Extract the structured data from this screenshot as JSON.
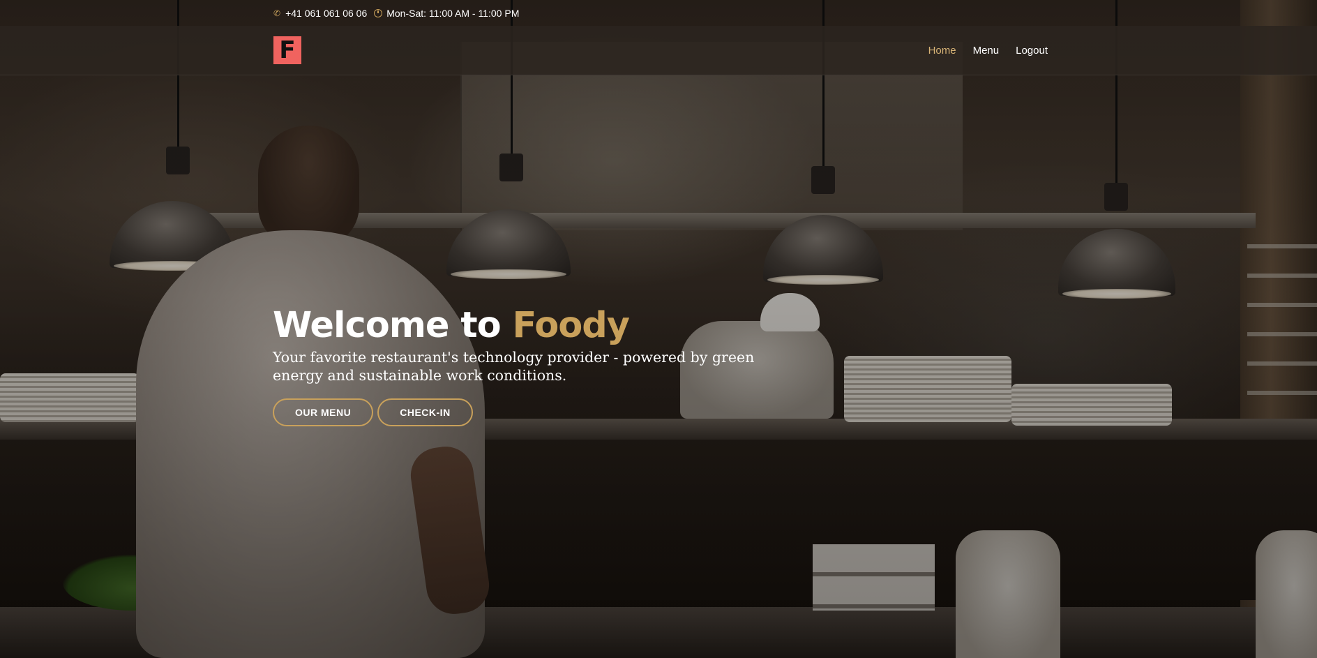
{
  "topbar": {
    "phone_icon": "phone-icon",
    "phone": "+41 061 061 06 06",
    "hours_icon": "clock-icon",
    "hours": "Mon-Sat: 11:00 AM - 11:00 PM"
  },
  "navbar": {
    "logo_letter": "F",
    "links": [
      {
        "label": "Home",
        "active": true
      },
      {
        "label": "Menu",
        "active": false
      },
      {
        "label": "Logout",
        "active": false
      }
    ]
  },
  "hero": {
    "title_prefix": "Welcome to",
    "title_brand": "Foody",
    "subtitle": "Your favorite restaurant's technology provider - powered by green energy and sustainable work conditions.",
    "buttons": [
      {
        "label": "OUR MENU"
      },
      {
        "label": "CHECK-IN"
      }
    ]
  },
  "colors": {
    "accent_gold": "#c9a15b",
    "nav_active": "#d7b376",
    "logo_bg": "#f0635f",
    "navbar_bg": "#2b241f"
  }
}
